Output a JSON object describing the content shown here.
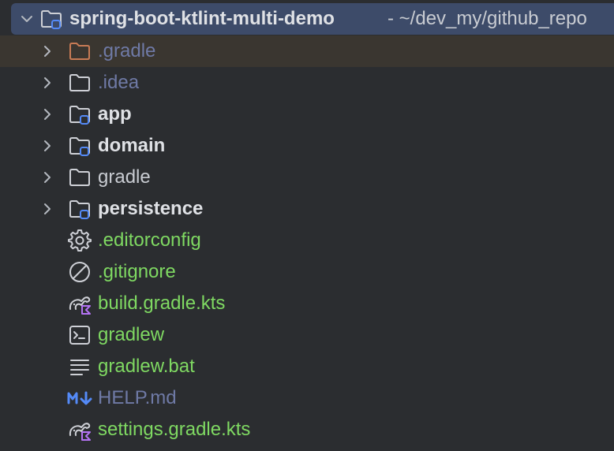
{
  "project": {
    "name": "spring-boot-ktlint-multi-demo",
    "path": "- ~/dev_my/github_repo"
  },
  "items": [
    {
      "label": ".gradle",
      "icon": "folder-icon"
    },
    {
      "label": ".idea",
      "icon": "folder-icon"
    },
    {
      "label": "app",
      "icon": "module-folder-icon"
    },
    {
      "label": "domain",
      "icon": "module-folder-icon"
    },
    {
      "label": "gradle",
      "icon": "folder-icon"
    },
    {
      "label": "persistence",
      "icon": "module-folder-icon"
    },
    {
      "label": ".editorconfig",
      "icon": "gear-icon"
    },
    {
      "label": ".gitignore",
      "icon": "ignore-icon"
    },
    {
      "label": "build.gradle.kts",
      "icon": "gradle-kotlin-icon"
    },
    {
      "label": "gradlew",
      "icon": "terminal-icon"
    },
    {
      "label": "gradlew.bat",
      "icon": "text-lines-icon"
    },
    {
      "label": "HELP.md",
      "icon": "markdown-icon"
    },
    {
      "label": "settings.gradle.kts",
      "icon": "gradle-kotlin-icon"
    }
  ],
  "colors": {
    "background": "#2b2d30",
    "selection": "#3d4b69",
    "excluded_highlight": "#3a3630",
    "new_file_green": "#7fd962",
    "excluded_text": "#6f7aa6",
    "module_badge": "#548af7",
    "kotlin_purple": "#b574f5",
    "excluded_folder_orange": "#c77b55"
  }
}
